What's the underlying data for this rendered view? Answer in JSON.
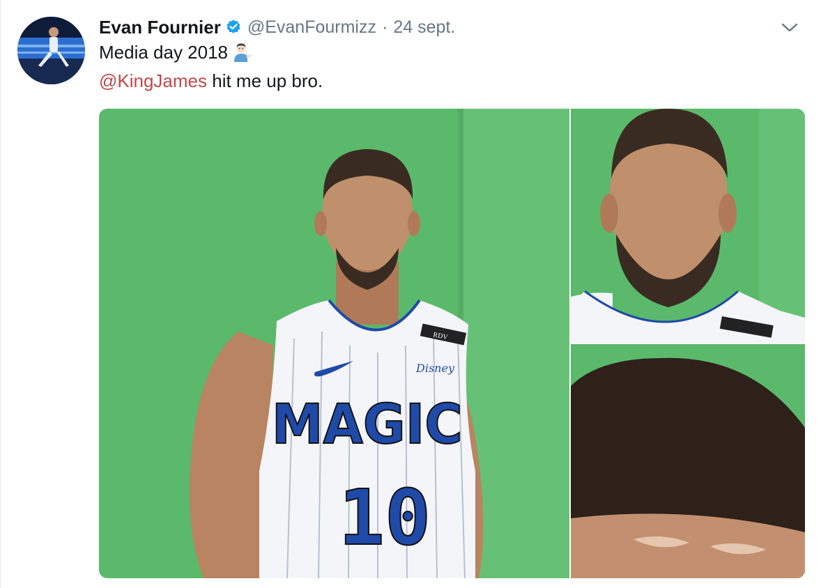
{
  "tweet": {
    "author_name": "Evan Fournier",
    "author_handle": "@EvanFourmizz",
    "separator": "·",
    "date": "24 sept.",
    "verified": true,
    "line1_text": "Media day 2018",
    "line1_emoji": "man-tipping-hand-emoji",
    "mention": "@KingJames",
    "line2_rest": " hit me up bro.",
    "menu_icon": "chevron-down-icon"
  },
  "jersey": {
    "team": "MAGIC",
    "number": "10",
    "sponsor": "Disney",
    "tag": "RDV"
  },
  "colors": {
    "name": "#14171a",
    "secondary": "#657786",
    "mention": "#c0484a",
    "verified": "#1da1f2",
    "greenscreen": "#5cba6c",
    "jersey_blue": "#1f4aa8"
  }
}
